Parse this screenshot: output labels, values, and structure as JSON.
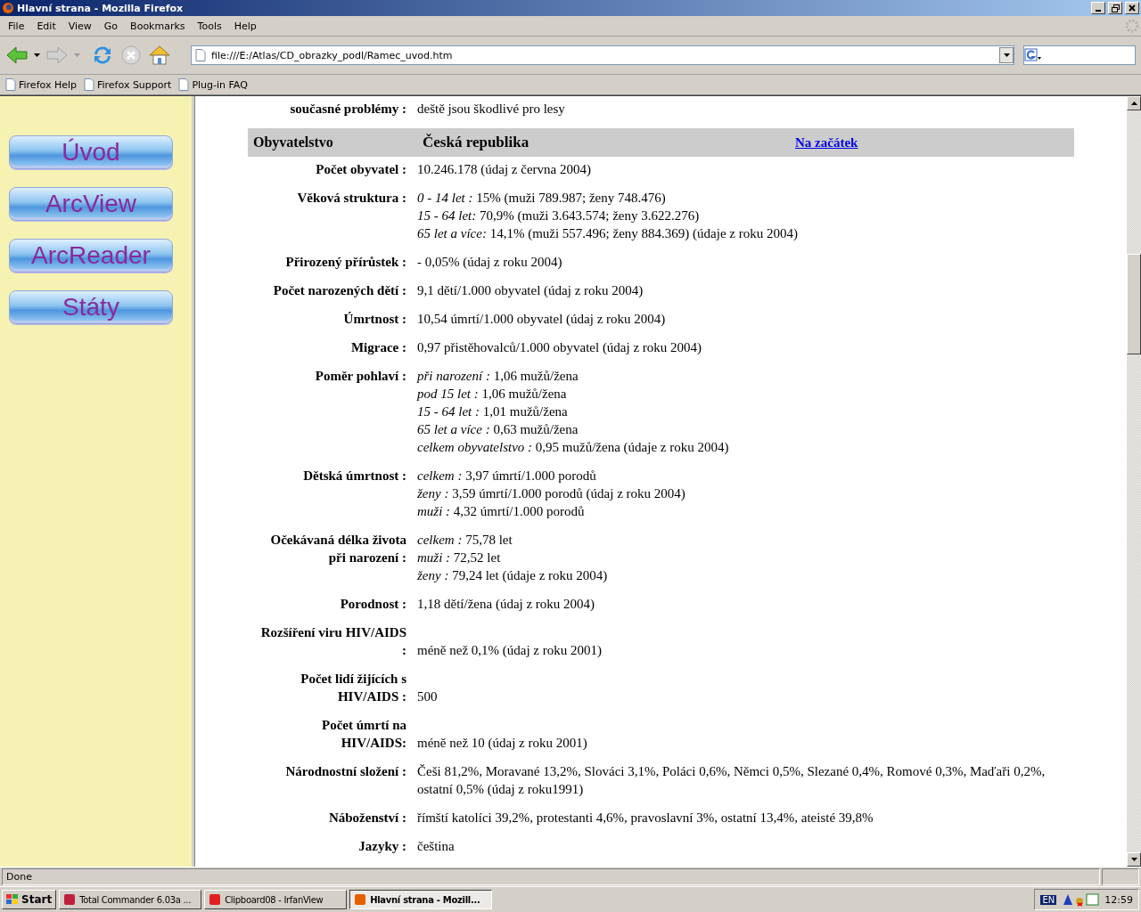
{
  "window": {
    "title": "Hlavní strana - Mozilla Firefox"
  },
  "menu": [
    "File",
    "Edit",
    "View",
    "Go",
    "Bookmarks",
    "Tools",
    "Help"
  ],
  "address": {
    "value": "file:///E:/Atlas/CD_obrazky_podl/Ramec_uvod.htm"
  },
  "bookmarks": [
    "Firefox Help",
    "Firefox Support",
    "Plug-in FAQ"
  ],
  "sidebar": {
    "buttons": [
      "Úvod",
      "ArcView",
      "ArcReader",
      "Státy"
    ]
  },
  "top_row": {
    "label": "současné problémy :",
    "value": "deště jsou škodlivé pro lesy"
  },
  "section": {
    "title": "Obyvatelstvo",
    "country": "Česká republika",
    "link": "Na začátek"
  },
  "rows": [
    {
      "kind": "top",
      "label": "Počet obyvatel :",
      "lines": [
        "10.246.178 (údaj z června 2004)"
      ]
    },
    {
      "kind": "top",
      "label": "Věková struktura :",
      "lines": [
        "*0 - 14 let :* 15% (muži 789.987; ženy 748.476)",
        "*15 - 64 let:* 70,9% (muži 3.643.574; ženy 3.622.276)",
        "*65 let a více:* 14,1% (muži 557.496; ženy 884.369) (údaje z roku 2004)"
      ]
    },
    {
      "kind": "top",
      "label": "Přirozený přírůstek :",
      "lines": [
        "- 0,05% (údaj z roku 2004)"
      ]
    },
    {
      "kind": "top",
      "label": "Počet narozených dětí :",
      "lines": [
        "9,1 dětí/1.000 obyvatel (údaj z roku 2004)"
      ]
    },
    {
      "kind": "top",
      "label": "Úmrtnost :",
      "lines": [
        "10,54 úmrtí/1.000 obyvatel (údaj z roku 2004)"
      ]
    },
    {
      "kind": "top",
      "label": "Migrace :",
      "lines": [
        "0,97 přistěhovalců/1.000 obyvatel (údaj z roku 2004)"
      ]
    },
    {
      "kind": "top",
      "label": "Poměr pohlaví :",
      "lines": [
        "*při narození :* 1,06 mužů/žena",
        "*pod 15 let :* 1,06 mužů/žena",
        "*15 - 64 let :* 1,01  mužů/žena",
        "*65 let a více :* 0,63  mužů/žena",
        "*celkem obyvatelstvo :* 0,95 mužů/žena (údaje z roku 2004)"
      ]
    },
    {
      "kind": "top",
      "label": "Dětská úmrtnost :",
      "lines": [
        "*celkem :* 3,97 úmrtí/1.000 porodů",
        "*ženy :* 3,59 úmrtí/1.000 porodů (údaj z roku 2004)",
        "*muži :* 4,32 úmrtí/1.000 porodů"
      ]
    },
    {
      "kind": "top",
      "label": "Očekávaná délka života\npři narození :",
      "lines": [
        "*celkem :* 75,78  let",
        "*muži :* 72,52  let",
        "*ženy :* 79,24 let (údaje z roku 2004)"
      ]
    },
    {
      "kind": "top",
      "label": "Porodnost :",
      "lines": [
        "1,18 dětí/žena (údaj z roku 2004)"
      ]
    },
    {
      "kind": "bottom",
      "label": "Rozšíření viru HIV/AIDS\n:",
      "lines": [
        "méně než 0,1%  (údaj z roku 2001)"
      ]
    },
    {
      "kind": "bottom",
      "label": "Počet lidí žijících s\nHIV/AIDS :",
      "lines": [
        "500"
      ]
    },
    {
      "kind": "bottom",
      "label": "Počet úmrtí na\nHIV/AIDS:",
      "lines": [
        "méně než 10 (údaj z roku 2001)"
      ]
    },
    {
      "kind": "top",
      "label": "Národnostní složení :",
      "lines": [
        "Češi 81,2%, Moravané 13,2%, Slováci 3,1%, Poláci 0,6%, Němci 0,5%, Slezané 0,4%, Romové 0,3%, Maďaři 0,2%,",
        "ostatní 0,5% (údaj z roku1991)"
      ]
    },
    {
      "kind": "top",
      "label": "Náboženství :",
      "lines": [
        "římští katolíci 39,2%, protestanti 4,6%, pravoslavní 3%, ostatní 13,4%, ateisté 39,8%"
      ]
    },
    {
      "kind": "top",
      "label": "Jazyky :",
      "lines": [
        "čeština"
      ]
    }
  ],
  "status_bar": {
    "text": "Done"
  },
  "taskbar": {
    "start": "Start",
    "tasks": [
      {
        "label": "Total Commander 6.03a ...",
        "selected": false
      },
      {
        "label": "Clipboard08 - IrfanView",
        "selected": false
      },
      {
        "label": "Hlavní strana - Mozill...",
        "selected": true
      }
    ],
    "language": "EN",
    "clock": "12:59"
  }
}
